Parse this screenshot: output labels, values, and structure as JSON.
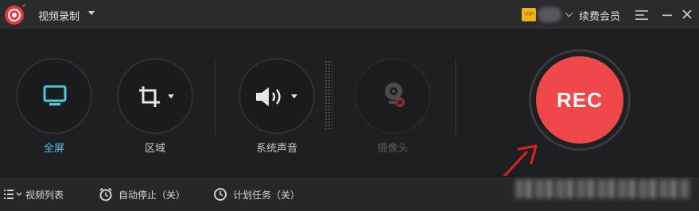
{
  "titlebar": {
    "app_title": "视频录制",
    "vip_badge": "VIP",
    "renew_label": "续费会员",
    "icons": [
      "app-logo-icon",
      "chevron-down-icon",
      "menu-icon",
      "minimize-icon",
      "close-icon"
    ]
  },
  "modes": {
    "fullscreen": {
      "label": "全屏",
      "icon": "monitor-icon",
      "active": true
    },
    "region": {
      "label": "区域",
      "icon": "crop-icon"
    },
    "system_audio": {
      "label": "系统声音",
      "icon": "speaker-icon"
    },
    "camera": {
      "label": "摄像头",
      "icon": "webcam-icon",
      "disabled": true
    }
  },
  "rec_button": {
    "label": "REC"
  },
  "bottombar": {
    "video_list": "视频列表",
    "auto_stop": "自动停止（关）",
    "schedule": "计划任务（关）"
  },
  "colors": {
    "accent": "#4fc6dc",
    "rec_red": "#f04848",
    "annotation_arrow": "#e02020",
    "background": "#1e1f22"
  }
}
